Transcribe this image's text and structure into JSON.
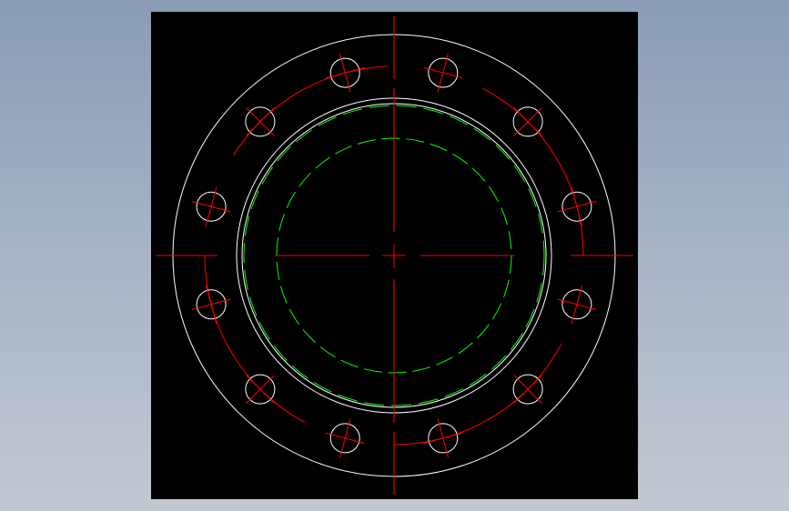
{
  "drawing": {
    "background": "#000000",
    "colors": {
      "outline": "#ffffff",
      "centerline": "#ff0000",
      "hidden": "#00ff00"
    },
    "bolt_hole_count": 12
  }
}
